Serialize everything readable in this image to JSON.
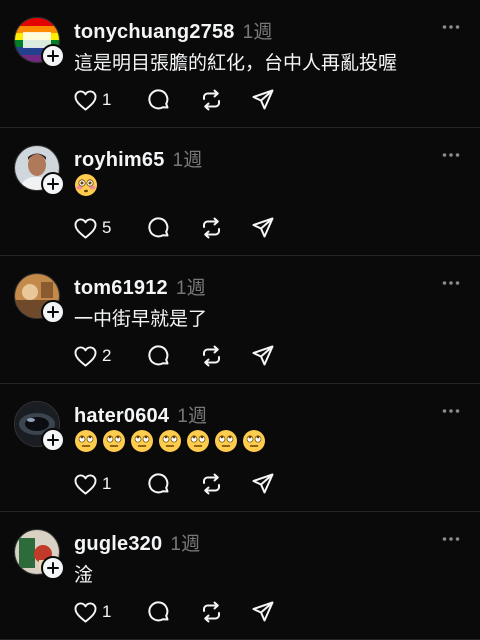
{
  "posts": [
    {
      "username": "tonychuang2758",
      "time": "1週",
      "text": "這是明目張膽的紅化，台中人再亂投喔",
      "emoji_count": 0,
      "likes": "1"
    },
    {
      "username": "royhim65",
      "time": "1週",
      "text": "",
      "emoji_count": 1,
      "emoji_kind": "flushed-emoji",
      "likes": "5"
    },
    {
      "username": "tom61912",
      "time": "1週",
      "text": "一中街早就是了",
      "emoji_count": 0,
      "likes": "2"
    },
    {
      "username": "hater0604",
      "time": "1週",
      "text": "",
      "emoji_count": 7,
      "emoji_kind": "eye-roll-emoji",
      "likes": "1"
    },
    {
      "username": "gugle320",
      "time": "1週",
      "text": "淦",
      "emoji_count": 0,
      "likes": "1"
    }
  ],
  "icons": [
    "heart-icon",
    "reply-icon",
    "repost-icon",
    "share-icon",
    "more-icon",
    "follow-plus-icon"
  ],
  "colors": {
    "background": "#0a0a0a",
    "text": "#f3f5f7",
    "muted": "#777777",
    "divider": "#262626"
  }
}
